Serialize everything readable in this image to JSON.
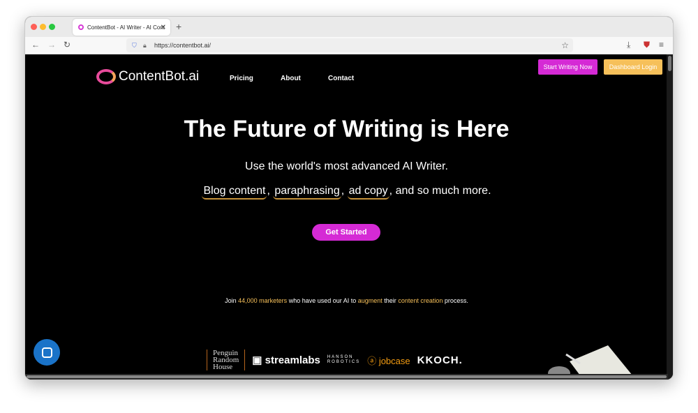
{
  "browser": {
    "tab_title": "ContentBot - AI Writer - AI Cont",
    "url": "https://contentbot.ai/"
  },
  "header": {
    "brand": "ContentBot.ai",
    "nav": [
      "Pricing",
      "About",
      "Contact"
    ],
    "start_writing": "Start Writing Now",
    "dashboard_login": "Dashboard Login"
  },
  "hero": {
    "title": "The Future of Writing is Here",
    "subtitle": "Use the world's most advanced AI Writer.",
    "features": [
      "Blog content",
      "paraphrasing",
      "ad copy"
    ],
    "features_tail": ", and so much more.",
    "cta": "Get Started"
  },
  "social_proof": {
    "p1": "Join ",
    "count": "44,000 marketers",
    "p2": " who have used our AI to ",
    "augment": "augment",
    "p3": " their ",
    "content": "content creation",
    "p4": " process."
  },
  "logos": {
    "penguin": [
      "Penguin",
      "Random",
      "House"
    ],
    "streamlabs": "streamlabs",
    "hanson": [
      "HANSON",
      "ROBOTICS"
    ],
    "jobcase": "jobcase",
    "koch": "KOCH."
  },
  "colors": {
    "accent": "#d52ad5",
    "gold": "#f6c05a",
    "background": "#000000"
  }
}
